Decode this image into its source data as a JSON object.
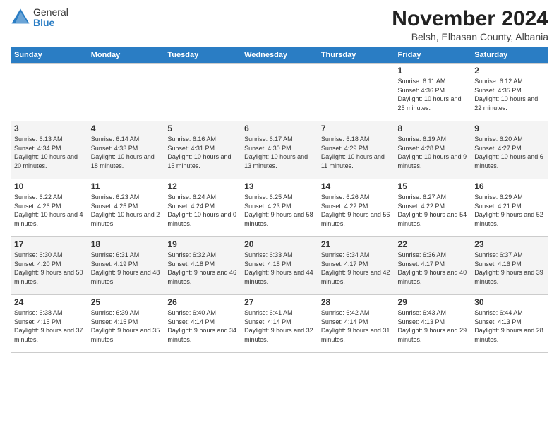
{
  "logo": {
    "general": "General",
    "blue": "Blue"
  },
  "title": "November 2024",
  "location": "Belsh, Elbasan County, Albania",
  "days_header": [
    "Sunday",
    "Monday",
    "Tuesday",
    "Wednesday",
    "Thursday",
    "Friday",
    "Saturday"
  ],
  "weeks": [
    [
      {
        "day": "",
        "info": ""
      },
      {
        "day": "",
        "info": ""
      },
      {
        "day": "",
        "info": ""
      },
      {
        "day": "",
        "info": ""
      },
      {
        "day": "",
        "info": ""
      },
      {
        "day": "1",
        "info": "Sunrise: 6:11 AM\nSunset: 4:36 PM\nDaylight: 10 hours and 25 minutes."
      },
      {
        "day": "2",
        "info": "Sunrise: 6:12 AM\nSunset: 4:35 PM\nDaylight: 10 hours and 22 minutes."
      }
    ],
    [
      {
        "day": "3",
        "info": "Sunrise: 6:13 AM\nSunset: 4:34 PM\nDaylight: 10 hours and 20 minutes."
      },
      {
        "day": "4",
        "info": "Sunrise: 6:14 AM\nSunset: 4:33 PM\nDaylight: 10 hours and 18 minutes."
      },
      {
        "day": "5",
        "info": "Sunrise: 6:16 AM\nSunset: 4:31 PM\nDaylight: 10 hours and 15 minutes."
      },
      {
        "day": "6",
        "info": "Sunrise: 6:17 AM\nSunset: 4:30 PM\nDaylight: 10 hours and 13 minutes."
      },
      {
        "day": "7",
        "info": "Sunrise: 6:18 AM\nSunset: 4:29 PM\nDaylight: 10 hours and 11 minutes."
      },
      {
        "day": "8",
        "info": "Sunrise: 6:19 AM\nSunset: 4:28 PM\nDaylight: 10 hours and 9 minutes."
      },
      {
        "day": "9",
        "info": "Sunrise: 6:20 AM\nSunset: 4:27 PM\nDaylight: 10 hours and 6 minutes."
      }
    ],
    [
      {
        "day": "10",
        "info": "Sunrise: 6:22 AM\nSunset: 4:26 PM\nDaylight: 10 hours and 4 minutes."
      },
      {
        "day": "11",
        "info": "Sunrise: 6:23 AM\nSunset: 4:25 PM\nDaylight: 10 hours and 2 minutes."
      },
      {
        "day": "12",
        "info": "Sunrise: 6:24 AM\nSunset: 4:24 PM\nDaylight: 10 hours and 0 minutes."
      },
      {
        "day": "13",
        "info": "Sunrise: 6:25 AM\nSunset: 4:23 PM\nDaylight: 9 hours and 58 minutes."
      },
      {
        "day": "14",
        "info": "Sunrise: 6:26 AM\nSunset: 4:22 PM\nDaylight: 9 hours and 56 minutes."
      },
      {
        "day": "15",
        "info": "Sunrise: 6:27 AM\nSunset: 4:22 PM\nDaylight: 9 hours and 54 minutes."
      },
      {
        "day": "16",
        "info": "Sunrise: 6:29 AM\nSunset: 4:21 PM\nDaylight: 9 hours and 52 minutes."
      }
    ],
    [
      {
        "day": "17",
        "info": "Sunrise: 6:30 AM\nSunset: 4:20 PM\nDaylight: 9 hours and 50 minutes."
      },
      {
        "day": "18",
        "info": "Sunrise: 6:31 AM\nSunset: 4:19 PM\nDaylight: 9 hours and 48 minutes."
      },
      {
        "day": "19",
        "info": "Sunrise: 6:32 AM\nSunset: 4:18 PM\nDaylight: 9 hours and 46 minutes."
      },
      {
        "day": "20",
        "info": "Sunrise: 6:33 AM\nSunset: 4:18 PM\nDaylight: 9 hours and 44 minutes."
      },
      {
        "day": "21",
        "info": "Sunrise: 6:34 AM\nSunset: 4:17 PM\nDaylight: 9 hours and 42 minutes."
      },
      {
        "day": "22",
        "info": "Sunrise: 6:36 AM\nSunset: 4:17 PM\nDaylight: 9 hours and 40 minutes."
      },
      {
        "day": "23",
        "info": "Sunrise: 6:37 AM\nSunset: 4:16 PM\nDaylight: 9 hours and 39 minutes."
      }
    ],
    [
      {
        "day": "24",
        "info": "Sunrise: 6:38 AM\nSunset: 4:15 PM\nDaylight: 9 hours and 37 minutes."
      },
      {
        "day": "25",
        "info": "Sunrise: 6:39 AM\nSunset: 4:15 PM\nDaylight: 9 hours and 35 minutes."
      },
      {
        "day": "26",
        "info": "Sunrise: 6:40 AM\nSunset: 4:14 PM\nDaylight: 9 hours and 34 minutes."
      },
      {
        "day": "27",
        "info": "Sunrise: 6:41 AM\nSunset: 4:14 PM\nDaylight: 9 hours and 32 minutes."
      },
      {
        "day": "28",
        "info": "Sunrise: 6:42 AM\nSunset: 4:14 PM\nDaylight: 9 hours and 31 minutes."
      },
      {
        "day": "29",
        "info": "Sunrise: 6:43 AM\nSunset: 4:13 PM\nDaylight: 9 hours and 29 minutes."
      },
      {
        "day": "30",
        "info": "Sunrise: 6:44 AM\nSunset: 4:13 PM\nDaylight: 9 hours and 28 minutes."
      }
    ]
  ]
}
